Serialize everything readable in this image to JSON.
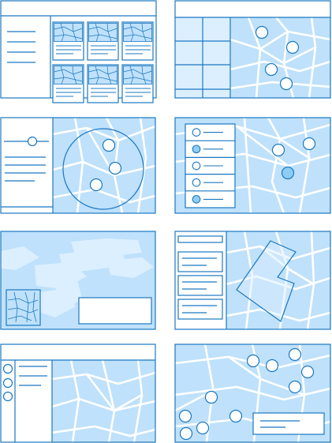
{
  "palette": {
    "line": "#1a78c2",
    "map_fill": "#bfe1fb",
    "map_light": "#dcefff",
    "street": "#ffffff",
    "pin_fill": "#ffffff",
    "pin_selected": "#8fcdf6",
    "background": "#ffffff"
  },
  "layouts": [
    {
      "name": "gallery-grid",
      "items": 6
    },
    {
      "name": "table-with-map",
      "pins": 4
    },
    {
      "name": "radius-search",
      "pins": 3
    },
    {
      "name": "checklist-filter",
      "options": 5,
      "checked": [
        false,
        true,
        false,
        false,
        true
      ]
    },
    {
      "name": "3d-view-with-minimap"
    },
    {
      "name": "area-draw"
    },
    {
      "name": "sidebar-list-map",
      "items": 3
    },
    {
      "name": "pins-with-callout",
      "pins": 10
    }
  ]
}
